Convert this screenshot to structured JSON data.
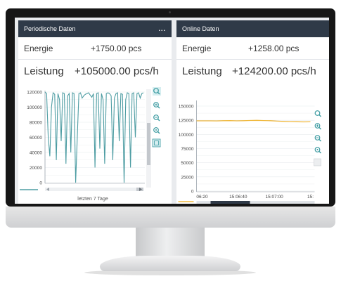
{
  "panels": {
    "periodic": {
      "title": "Periodische Daten",
      "menu": "...",
      "energy_label": "Energie",
      "energy_value": "+1750.00 pcs",
      "power_label": "Leistung",
      "power_value": "+105000.00 pcs/h",
      "footer": "letzten 7 Tage"
    },
    "online": {
      "title": "Online Daten",
      "energy_label": "Energie",
      "energy_value": "+1258.00 pcs",
      "power_label": "Leistung",
      "power_value": "+124200.00 pcs/h"
    }
  },
  "chart_data": [
    {
      "type": "line",
      "ylim": [
        0,
        120000
      ],
      "yticks": [
        0,
        20000,
        40000,
        60000,
        80000,
        100000,
        120000
      ],
      "ytick_labels": [
        "0",
        "20000",
        "40000",
        "60000",
        "80000",
        "100000",
        "120000"
      ],
      "color": "#4e9da3",
      "series": [
        {
          "values": [
            120000,
            118000,
            60000,
            35000,
            100000,
            119000,
            117000,
            30000,
            118000,
            110000,
            55000,
            119000,
            118000,
            25000,
            115000,
            118000,
            40000,
            119000,
            118000,
            0,
            60000,
            118000,
            119000,
            112000,
            115000,
            117000,
            118000,
            119000,
            116000,
            113000,
            118000,
            20000,
            118000,
            119000,
            45000,
            118000,
            110000,
            25000,
            118000,
            119000,
            118000,
            115000,
            30000,
            112000,
            118000,
            119000,
            55000,
            118000,
            117000,
            0,
            110000,
            119000,
            118000,
            20000,
            118000,
            119000,
            60000,
            118000,
            119000,
            112000,
            118000,
            119000
          ]
        }
      ]
    },
    {
      "type": "line",
      "ylim": [
        0,
        150000
      ],
      "yticks": [
        0,
        25000,
        50000,
        75000,
        100000,
        125000,
        150000
      ],
      "ytick_labels": [
        "0",
        "25000",
        "50000",
        "75000",
        "100000",
        "125000",
        "150000"
      ],
      "x_tick_labels": [
        "06:20",
        "15:06:40",
        "15:07:00",
        "15:"
      ],
      "color": "#f0b83c",
      "series": [
        {
          "values": [
            124000,
            124000,
            124000,
            123800,
            124200,
            124300,
            124000,
            124200,
            124600,
            124800,
            124500,
            124200,
            123500,
            123000,
            122600,
            122400,
            122100,
            122200
          ]
        }
      ]
    }
  ]
}
